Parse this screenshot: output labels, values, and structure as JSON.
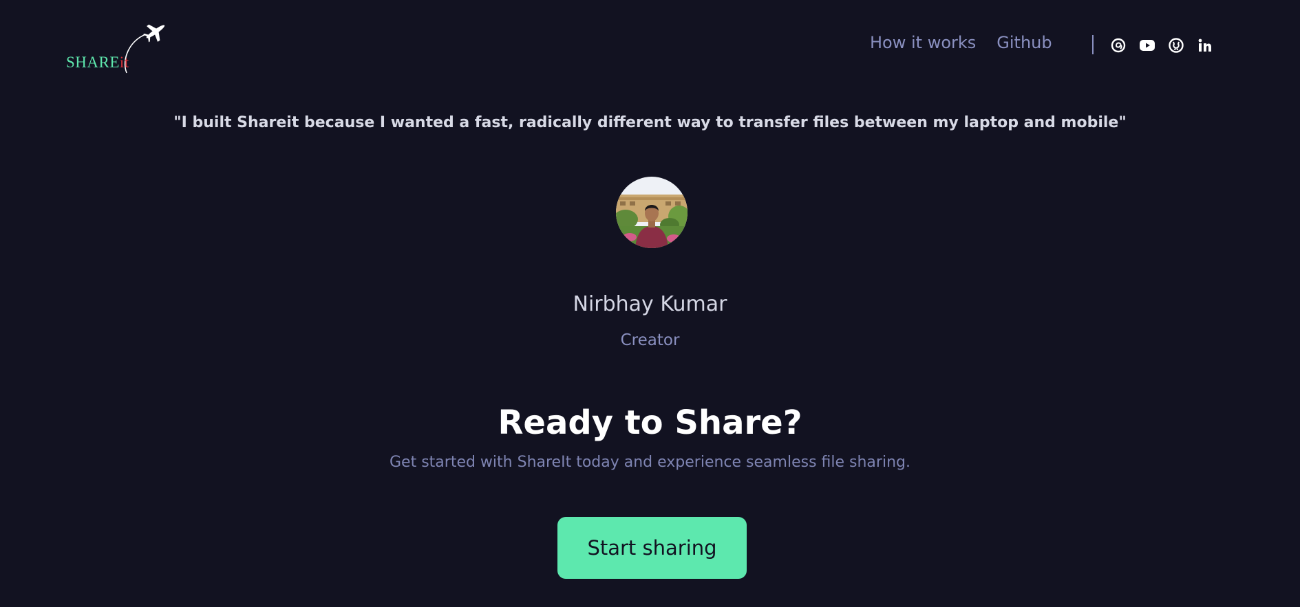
{
  "header": {
    "logo": {
      "text_main": "SHARE",
      "text_accent": "it",
      "icon": "airplane-icon"
    },
    "nav": [
      {
        "label": "How it works"
      },
      {
        "label": "Github"
      }
    ],
    "social": [
      {
        "icon": "threads-icon"
      },
      {
        "icon": "youtube-icon"
      },
      {
        "icon": "github-icon"
      },
      {
        "icon": "linkedin-icon"
      }
    ]
  },
  "testimonial": {
    "quote": "\"I built Shareit because I wanted a fast, radically different way to transfer files between my laptop and mobile\"",
    "name": "Nirbhay Kumar",
    "role": "Creator"
  },
  "cta": {
    "title": "Ready to Share?",
    "subtitle": "Get started with ShareIt today and experience seamless file sharing.",
    "button_label": "Start sharing"
  },
  "colors": {
    "background": "#121221",
    "accent": "#5de8ae",
    "muted": "#8a90c0",
    "logo_red": "#d9333a"
  }
}
